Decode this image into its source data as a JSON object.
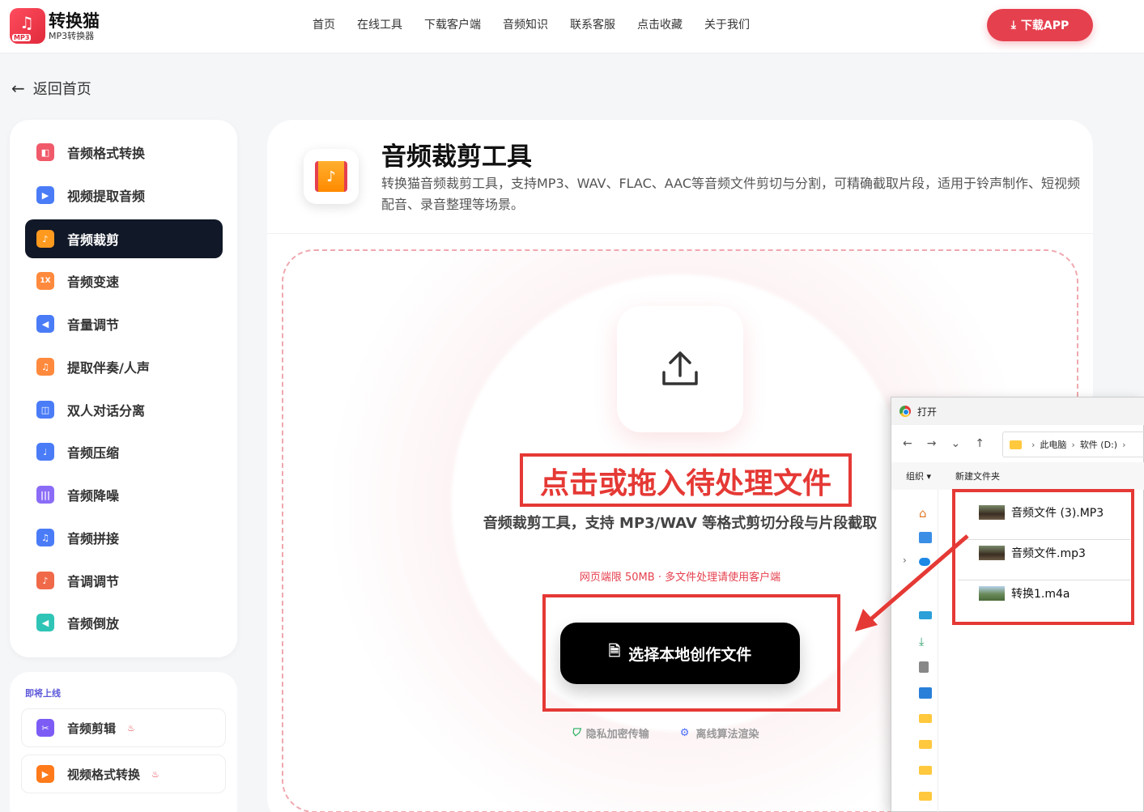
{
  "header": {
    "logo_title": "转换猫",
    "logo_sub": "MP3转换器",
    "logo_badge": "MP3",
    "nav": [
      "首页",
      "在线工具",
      "下载客户端",
      "音频知识",
      "联系客服",
      "点击收藏",
      "关于我们"
    ],
    "download_app": "下载APP"
  },
  "back_label": "返回首页",
  "sidebar": {
    "items": [
      {
        "label": "音频格式转换",
        "icon": "format-convert-icon",
        "color": "#f05a6a"
      },
      {
        "label": "视频提取音频",
        "icon": "video-extract-icon",
        "color": "#4a7cf7"
      },
      {
        "label": "音频裁剪",
        "icon": "audio-cut-icon",
        "color": "#ff9a1f",
        "active": true
      },
      {
        "label": "音频变速",
        "icon": "speed-icon",
        "color": "#ff8a3d",
        "badge": "1X"
      },
      {
        "label": "音量调节",
        "icon": "volume-icon",
        "color": "#4a7cf7"
      },
      {
        "label": "提取伴奏/人声",
        "icon": "vocal-extract-icon",
        "color": "#ff8a3d"
      },
      {
        "label": "双人对话分离",
        "icon": "dialog-split-icon",
        "color": "#4a7cf7"
      },
      {
        "label": "音频压缩",
        "icon": "compress-icon",
        "color": "#4a7cf7"
      },
      {
        "label": "音频降噪",
        "icon": "denoise-icon",
        "color": "#8b6cf7"
      },
      {
        "label": "音频拼接",
        "icon": "merge-icon",
        "color": "#4a7cf7"
      },
      {
        "label": "音调调节",
        "icon": "pitch-icon",
        "color": "#f06a4a"
      },
      {
        "label": "音频倒放",
        "icon": "reverse-icon",
        "color": "#2ec4b6"
      }
    ]
  },
  "coming_soon": {
    "title": "即将上线",
    "items": [
      {
        "label": "音频剪辑",
        "icon": "scissors-icon",
        "color": "#7c5cf5"
      },
      {
        "label": "视频格式转换",
        "icon": "video-convert-icon",
        "color": "#ff7a1a"
      }
    ]
  },
  "tool": {
    "title": "音频裁剪工具",
    "description": "转换猫音频裁剪工具，支持MP3、WAV、FLAC、AAC等音频文件剪切与分割，可精确截取片段，适用于铃声制作、短视频配音、录音整理等场景。"
  },
  "dropzone": {
    "title": "点击或拖入待处理文件",
    "subtitle": "音频裁剪工具，支持 MP3/WAV 等格式剪切分段与片段截取",
    "limit_left": "网页端限 50MB",
    "limit_dot": "·",
    "limit_right": "多文件处理请使用客户端",
    "choose_button": "选择本地创作文件",
    "badge_privacy": "隐私加密传输",
    "badge_offline": "离线算法渲染"
  },
  "file_dialog": {
    "title": "打开",
    "path": [
      "此电脑",
      "软件 (D:)"
    ],
    "organize": "组织",
    "new_folder": "新建文件夹",
    "files": [
      "音频文件 (3).MP3",
      "音频文件.mp3",
      "转换1.m4a"
    ]
  }
}
